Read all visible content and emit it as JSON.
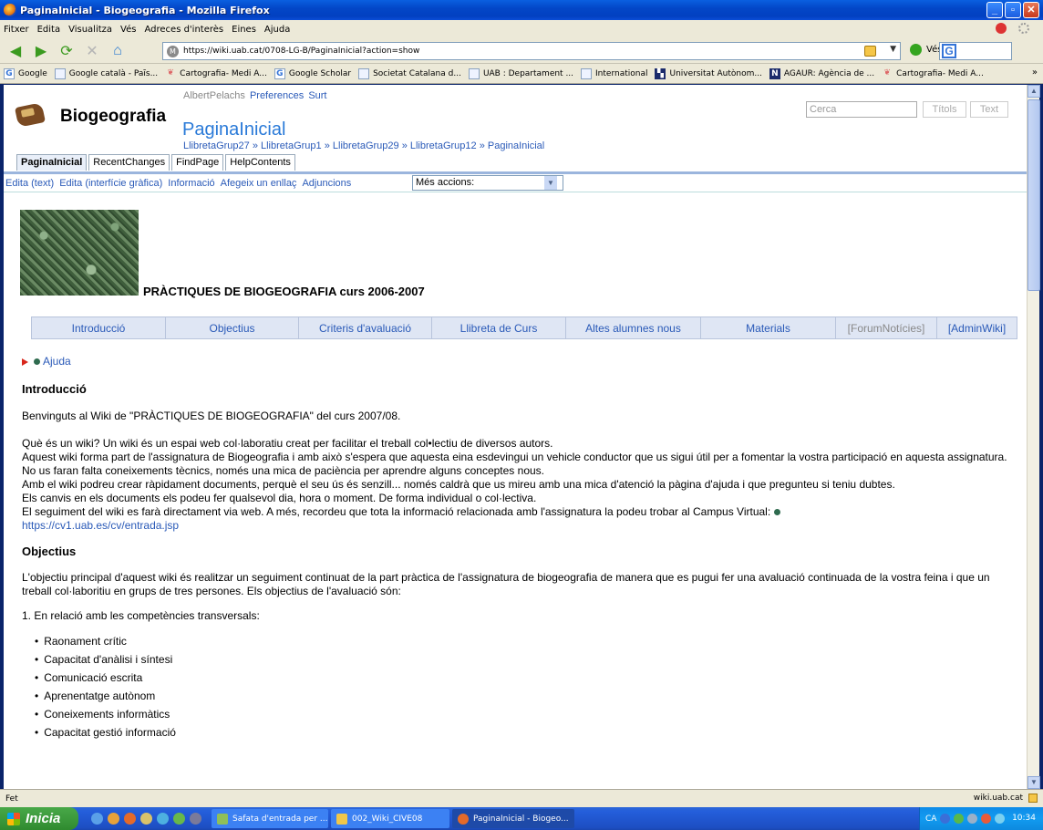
{
  "window": {
    "title": "PaginaInicial - Biogeografia - Mozilla Firefox"
  },
  "menubar": {
    "items": [
      "Fitxer",
      "Edita",
      "Visualitza",
      "Vés",
      "Adreces d'interès",
      "Eines",
      "Ajuda"
    ]
  },
  "navbar": {
    "url": "https://wiki.uab.cat/0708-LG-B/PaginaInicial?action=show",
    "go_label": "Vés"
  },
  "bookmarks": [
    {
      "label": "Google",
      "icon": "google-icon"
    },
    {
      "label": "Google català - Paīs...",
      "icon": "page-icon"
    },
    {
      "label": "Cartografia- Medi A...",
      "icon": "map-icon"
    },
    {
      "label": "Google Scholar",
      "icon": "google-icon"
    },
    {
      "label": "Societat Catalana d...",
      "icon": "page-icon"
    },
    {
      "label": "UAB : Departament ...",
      "icon": "page-icon"
    },
    {
      "label": "International",
      "icon": "page-icon"
    },
    {
      "label": "Universitat Autònom...",
      "icon": "uab-icon"
    },
    {
      "label": "AGAUR: Agència de ...",
      "icon": "agaur-icon"
    },
    {
      "label": "Cartografia- Medi A...",
      "icon": "map-icon"
    }
  ],
  "bookmarks_more": "»",
  "wiki": {
    "site_name": "Biogeografia",
    "user": "AlbertPelachs",
    "user_links": [
      "Preferences",
      "Surt"
    ],
    "page_title": "PaginaInicial",
    "breadcrumb": "LlibretaGrup27 » LlibretaGrup1 » LlibretaGrup29 » LlibretaGrup12 » PaginaInicial",
    "search_placeholder": "Cerca",
    "btn_titles": "Títols",
    "btn_text": "Text",
    "tabs": [
      "PaginaInicial",
      "RecentChanges",
      "FindPage",
      "HelpContents"
    ],
    "edit_links": [
      "Edita (text)",
      "Edita (interfície gràfica)",
      "Informació",
      "Afegeix un enllaç",
      "Adjuncions"
    ],
    "more_actions": "Més accions:",
    "heading": "PRÀCTIQUES DE BIOGEOGRAFIA curs 2006-2007",
    "menu": [
      "Introducció",
      "Objectius",
      "Criteris d'avaluació",
      "Llibreta de Curs",
      "Altes alumnes nous",
      "Materials",
      "[ForumNotícies]",
      "[AdminWiki]"
    ],
    "ajuda": "Ajuda",
    "intro_heading": "Introducció",
    "intro_welcome": "Benvinguts al Wiki de \"PRÀCTIQUES DE BIOGEOGRAFIA\" del curs 2007/08.",
    "intro_p1": "Què és un wiki? Un wiki és un espai web col·laboratiu creat per facilitar el treball col•lectiu de diversos autors.",
    "intro_p2": "Aquest wiki forma part de l'assignatura de Biogeografia i amb això s'espera que aquesta eina esdevingui un vehicle conductor que us sigui útil per a fomentar la vostra participació en aquesta assignatura. No us faran falta coneixements tècnics, només una mica de paciència per aprendre alguns conceptes nous.",
    "intro_p3": "Amb el wiki podreu crear ràpidament documents, perquè el seu ús és senzill... només caldrà que us mireu amb una mica d'atenció la pàgina d'ajuda i que pregunteu si teniu dubtes.",
    "intro_p4": "Els canvis en els documents els podeu fer qualsevol dia, hora o moment. De forma individual o col·lectiva.",
    "intro_p5": "El seguiment del wiki es farà directament via web. A més, recordeu que tota la informació relacionada amb l'assignatura la podeu trobar al Campus Virtual:",
    "campus_link": "https://cv1.uab.es/cv/entrada.jsp",
    "obj_heading": "Objectius",
    "obj_p1": "L'objectiu principal d'aquest wiki és realitzar un seguiment continuat de la part pràctica de l'assignatura de biogeografia de manera que es pugui fer una avaluació continuada de la vostra feina i que un treball col·laboritiu en grups de tres persones. Els objectius de l'avaluació són:",
    "obj_list_intro": "1. En relació amb les competències transversals:",
    "competencies": [
      "Raonament crític",
      "Capacitat d'anàlisi i síntesi",
      "Comunicació escrita",
      "Aprenentatge autònom",
      "Coneixements informàtics",
      "Capacitat gestió informació"
    ]
  },
  "status": {
    "left": "Fet",
    "domain": "wiki.uab.cat"
  },
  "taskbar": {
    "start": "Inicia",
    "tasks": [
      "Safata d'entrada per ...",
      "002_Wiki_CIVE08",
      "PaginaInicial - Biogeo..."
    ],
    "lang": "CA",
    "clock": "10:34"
  }
}
